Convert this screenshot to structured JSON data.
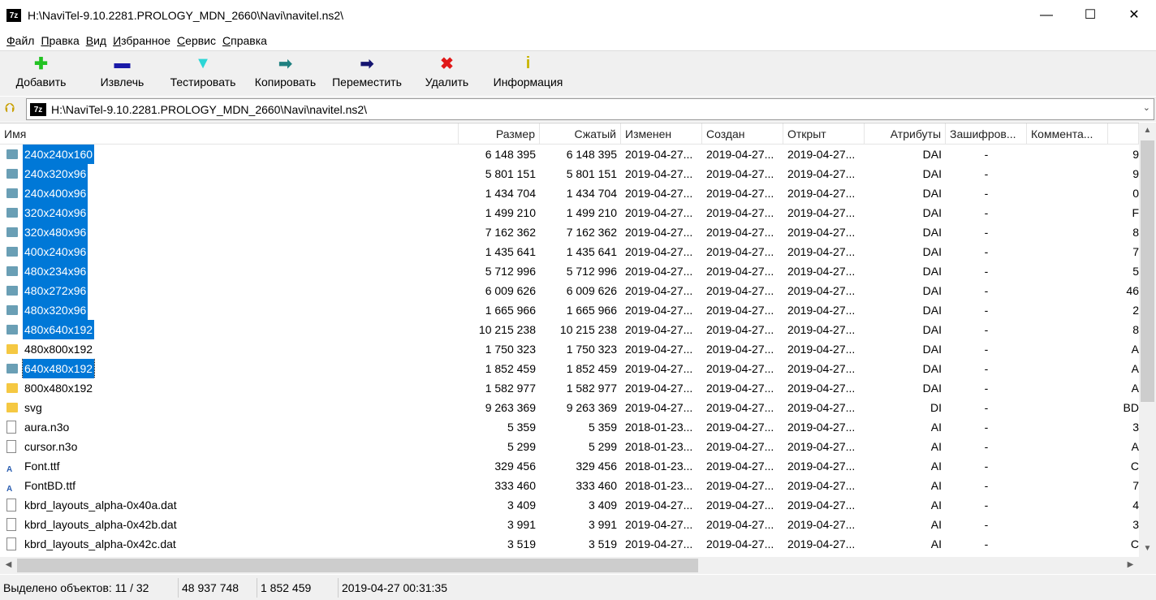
{
  "window": {
    "title": "H:\\NaviTel-9.10.2281.PROLOGY_MDN_2660\\Navi\\navitel.ns2\\",
    "app_icon": "7z",
    "minimize": "—",
    "maximize": "☐",
    "close": "✕"
  },
  "menu": [
    {
      "u": "Ф",
      "rest": "айл"
    },
    {
      "u": "П",
      "rest": "равка"
    },
    {
      "u": "В",
      "rest": "ид"
    },
    {
      "u": "И",
      "rest": "збранное"
    },
    {
      "u": "С",
      "rest": "ервис"
    },
    {
      "u": "С",
      "rest": "правка"
    }
  ],
  "toolbar": [
    {
      "label": "Добавить",
      "icon": "plus-icon",
      "glyph": "✚",
      "color": "#22c222"
    },
    {
      "label": "Извлечь",
      "icon": "minus-icon",
      "glyph": "▬",
      "color": "#1a1aa8"
    },
    {
      "label": "Тестировать",
      "icon": "check-icon",
      "glyph": "▼",
      "color": "#2cd6d6"
    },
    {
      "label": "Копировать",
      "icon": "copy-arrow-icon",
      "glyph": "➡",
      "color": "#1f8080"
    },
    {
      "label": "Переместить",
      "icon": "move-arrow-icon",
      "glyph": "➡",
      "color": "#141470"
    },
    {
      "label": "Удалить",
      "icon": "delete-icon",
      "glyph": "✖",
      "color": "#e01818"
    },
    {
      "label": "Информация",
      "icon": "info-icon",
      "glyph": "i",
      "color": "#c8b400"
    }
  ],
  "address": {
    "path": "H:\\NaviTel-9.10.2281.PROLOGY_MDN_2660\\Navi\\navitel.ns2\\"
  },
  "columns": [
    "Имя",
    "Размер",
    "Сжатый",
    "Изменен",
    "Создан",
    "Открыт",
    "Атрибуты",
    "Зашифров...",
    "Коммента...",
    ""
  ],
  "rows": [
    {
      "t": "folder",
      "sel": true,
      "v": [
        "240x240x160",
        "6 148 395",
        "6 148 395",
        "2019-04-27...",
        "2019-04-27...",
        "2019-04-27...",
        "DAI",
        "-",
        "",
        "9"
      ]
    },
    {
      "t": "folder",
      "sel": true,
      "v": [
        "240x320x96",
        "5 801 151",
        "5 801 151",
        "2019-04-27...",
        "2019-04-27...",
        "2019-04-27...",
        "DAI",
        "-",
        "",
        "9"
      ]
    },
    {
      "t": "folder",
      "sel": true,
      "v": [
        "240x400x96",
        "1 434 704",
        "1 434 704",
        "2019-04-27...",
        "2019-04-27...",
        "2019-04-27...",
        "DAI",
        "-",
        "",
        "0"
      ]
    },
    {
      "t": "folder",
      "sel": true,
      "v": [
        "320x240x96",
        "1 499 210",
        "1 499 210",
        "2019-04-27...",
        "2019-04-27...",
        "2019-04-27...",
        "DAI",
        "-",
        "",
        "F"
      ]
    },
    {
      "t": "folder",
      "sel": true,
      "v": [
        "320x480x96",
        "7 162 362",
        "7 162 362",
        "2019-04-27...",
        "2019-04-27...",
        "2019-04-27...",
        "DAI",
        "-",
        "",
        "8"
      ]
    },
    {
      "t": "folder",
      "sel": true,
      "v": [
        "400x240x96",
        "1 435 641",
        "1 435 641",
        "2019-04-27...",
        "2019-04-27...",
        "2019-04-27...",
        "DAI",
        "-",
        "",
        "7"
      ]
    },
    {
      "t": "folder",
      "sel": true,
      "v": [
        "480x234x96",
        "5 712 996",
        "5 712 996",
        "2019-04-27...",
        "2019-04-27...",
        "2019-04-27...",
        "DAI",
        "-",
        "",
        "5"
      ]
    },
    {
      "t": "folder",
      "sel": true,
      "v": [
        "480x272x96",
        "6 009 626",
        "6 009 626",
        "2019-04-27...",
        "2019-04-27...",
        "2019-04-27...",
        "DAI",
        "-",
        "",
        "46"
      ]
    },
    {
      "t": "folder",
      "sel": true,
      "v": [
        "480x320x96",
        "1 665 966",
        "1 665 966",
        "2019-04-27...",
        "2019-04-27...",
        "2019-04-27...",
        "DAI",
        "-",
        "",
        "2"
      ]
    },
    {
      "t": "folder",
      "sel": true,
      "v": [
        "480x640x192",
        "10 215 238",
        "10 215 238",
        "2019-04-27...",
        "2019-04-27...",
        "2019-04-27...",
        "DAI",
        "-",
        "",
        "8"
      ]
    },
    {
      "t": "folder",
      "sel": false,
      "v": [
        "480x800x192",
        "1 750 323",
        "1 750 323",
        "2019-04-27...",
        "2019-04-27...",
        "2019-04-27...",
        "DAI",
        "-",
        "",
        "A"
      ]
    },
    {
      "t": "folder",
      "sel": true,
      "focus": true,
      "v": [
        "640x480x192",
        "1 852 459",
        "1 852 459",
        "2019-04-27...",
        "2019-04-27...",
        "2019-04-27...",
        "DAI",
        "-",
        "",
        "A"
      ]
    },
    {
      "t": "folder",
      "sel": false,
      "v": [
        "800x480x192",
        "1 582 977",
        "1 582 977",
        "2019-04-27...",
        "2019-04-27...",
        "2019-04-27...",
        "DAI",
        "-",
        "",
        "A"
      ]
    },
    {
      "t": "folder",
      "sel": false,
      "v": [
        "svg",
        "9 263 369",
        "9 263 369",
        "2019-04-27...",
        "2019-04-27...",
        "2019-04-27...",
        "DI",
        "-",
        "",
        "BD"
      ]
    },
    {
      "t": "file",
      "sel": false,
      "v": [
        "aura.n3o",
        "5 359",
        "5 359",
        "2018-01-23...",
        "2019-04-27...",
        "2019-04-27...",
        "AI",
        "-",
        "",
        "3"
      ]
    },
    {
      "t": "file",
      "sel": false,
      "v": [
        "cursor.n3o",
        "5 299",
        "5 299",
        "2018-01-23...",
        "2019-04-27...",
        "2019-04-27...",
        "AI",
        "-",
        "",
        "A"
      ]
    },
    {
      "t": "font",
      "sel": false,
      "v": [
        "Font.ttf",
        "329 456",
        "329 456",
        "2018-01-23...",
        "2019-04-27...",
        "2019-04-27...",
        "AI",
        "-",
        "",
        "C"
      ]
    },
    {
      "t": "font",
      "sel": false,
      "v": [
        "FontBD.ttf",
        "333 460",
        "333 460",
        "2018-01-23...",
        "2019-04-27...",
        "2019-04-27...",
        "AI",
        "-",
        "",
        "7"
      ]
    },
    {
      "t": "file",
      "sel": false,
      "v": [
        "kbrd_layouts_alpha-0x40a.dat",
        "3 409",
        "3 409",
        "2019-04-27...",
        "2019-04-27...",
        "2019-04-27...",
        "AI",
        "-",
        "",
        "4"
      ]
    },
    {
      "t": "file",
      "sel": false,
      "v": [
        "kbrd_layouts_alpha-0x42b.dat",
        "3 991",
        "3 991",
        "2019-04-27...",
        "2019-04-27...",
        "2019-04-27...",
        "AI",
        "-",
        "",
        "3"
      ]
    },
    {
      "t": "file",
      "sel": false,
      "v": [
        "kbrd_layouts_alpha-0x42c.dat",
        "3 519",
        "3 519",
        "2019-04-27...",
        "2019-04-27...",
        "2019-04-27...",
        "AI",
        "-",
        "",
        "C"
      ]
    }
  ],
  "status": {
    "selected": "Выделено объектов: 11 / 32",
    "size": "48 937 748",
    "packed": "1 852 459",
    "date": "2019-04-27 00:31:35"
  }
}
